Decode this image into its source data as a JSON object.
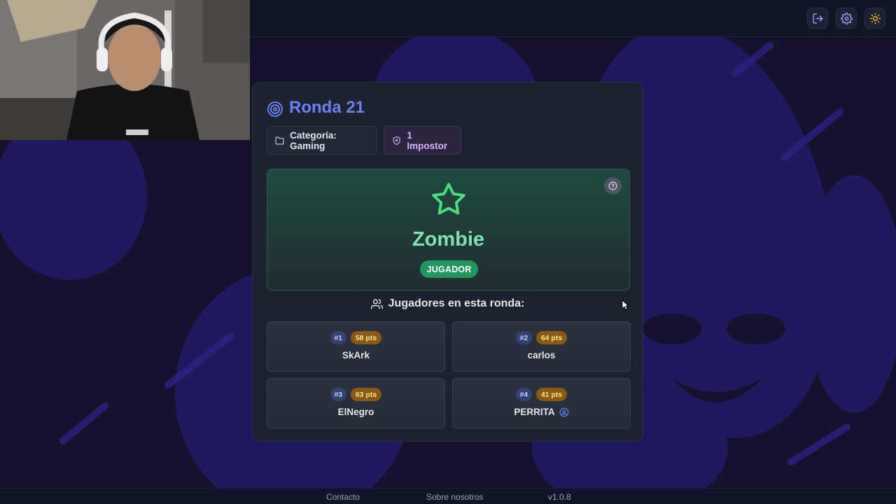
{
  "topbar": {
    "buttons": [
      {
        "icon": "logout-icon"
      },
      {
        "icon": "gear-icon"
      },
      {
        "icon": "sun-icon"
      }
    ]
  },
  "round": {
    "title": "Ronda 21",
    "category": "Categoría: Gaming",
    "impostors": "1 Impostor"
  },
  "word_panel": {
    "word": "Zombie",
    "role": "JUGADOR",
    "icon": "star-icon"
  },
  "players": {
    "heading": "Jugadores en esta ronda:",
    "list": [
      {
        "rank": "#1",
        "points": "58 pts",
        "name": "SkArk"
      },
      {
        "rank": "#2",
        "points": "64 pts",
        "name": "carlos"
      },
      {
        "rank": "#3",
        "points": "63 pts",
        "name": "ElNegro"
      },
      {
        "rank": "#4",
        "points": "41 pts",
        "name": "PERRITA"
      }
    ]
  },
  "footer": {
    "contact": "Contacto",
    "about": "Sobre nosotros",
    "version": "v1.0.8"
  },
  "colors": {
    "accent": "#6a82f0",
    "success": "#22965e",
    "word": "#7ee2b0",
    "impostor": "#d8b4fe",
    "points": "#8a5a14"
  }
}
